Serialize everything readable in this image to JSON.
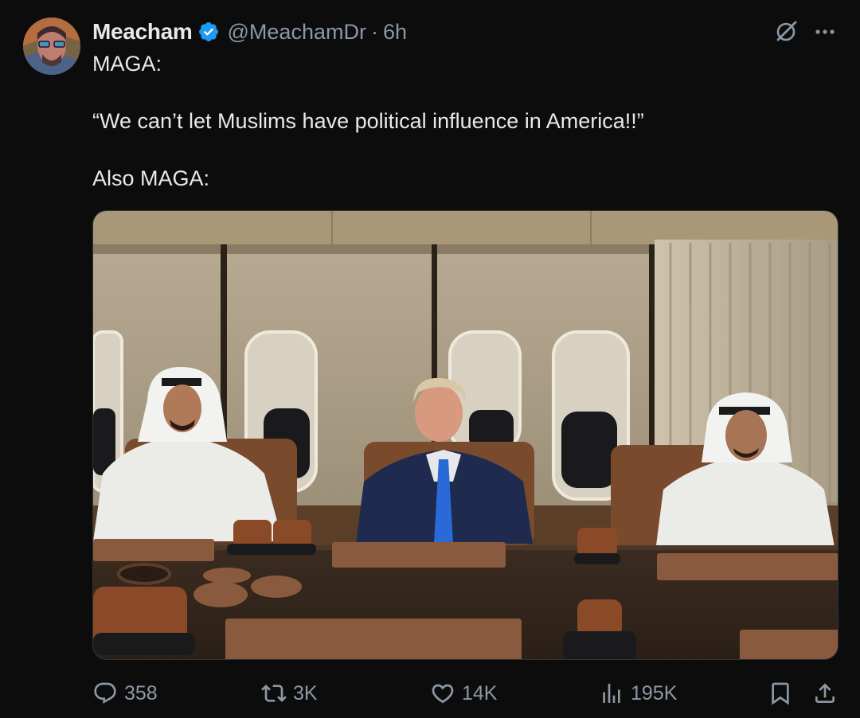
{
  "author": {
    "display_name": "Meacham",
    "handle": "@MeachamDr",
    "separator": "·",
    "time": "6h",
    "verified": true
  },
  "tweet": {
    "line1": "MAGA:",
    "line2": "“We can’t let Muslims have political influence in America!!”",
    "line3": "Also MAGA:"
  },
  "media": {
    "type": "photo"
  },
  "actions": {
    "replies": "358",
    "reposts": "3K",
    "likes": "14K",
    "views": "195K"
  },
  "icons": {
    "verified": "verified-badge-icon",
    "grok": "grok-icon",
    "more": "more-icon",
    "reply": "reply-icon",
    "repost": "repost-icon",
    "like": "heart-icon",
    "views": "views-icon",
    "bookmark": "bookmark-icon",
    "share": "share-icon"
  },
  "colors": {
    "background": "#0c0c0d",
    "text": "#e7e9ea",
    "muted": "#8b98a5",
    "verified": "#1d9bf0"
  }
}
